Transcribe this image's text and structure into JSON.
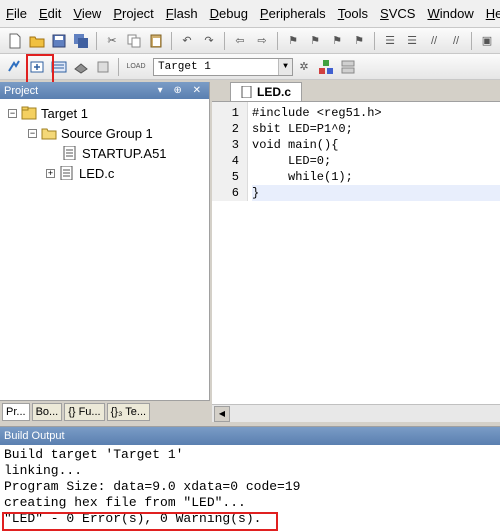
{
  "menu": [
    "File",
    "Edit",
    "View",
    "Project",
    "Flash",
    "Debug",
    "Peripherals",
    "Tools",
    "SVCS",
    "Window",
    "Help"
  ],
  "toolbar": {
    "load_label": "LOAD",
    "target_value": "Target 1"
  },
  "project_pane": {
    "title": "Project",
    "controls": "▾ ⊕ ✕",
    "tree": {
      "root": "Target 1",
      "group": "Source Group 1",
      "files": [
        "STARTUP.A51",
        "LED.c"
      ]
    },
    "tabs": [
      "Pr...",
      "Bo...",
      "{} Fu...",
      "{}₃ Te..."
    ]
  },
  "editor": {
    "tab_label": "LED.c",
    "lines": [
      {
        "num": "1",
        "code": "#include <reg51.h>"
      },
      {
        "num": "2",
        "code": "sbit LED=P1^0;"
      },
      {
        "num": "3",
        "code": "void main(){"
      },
      {
        "num": "4",
        "code": "     LED=0;"
      },
      {
        "num": "5",
        "code": "     while(1);"
      },
      {
        "num": "6",
        "code": "}"
      }
    ]
  },
  "build_output": {
    "title": "Build Output",
    "lines": [
      "Build target 'Target 1'",
      "linking...",
      "Program Size: data=9.0 xdata=0 code=19",
      "creating hex file from \"LED\"...",
      "\"LED\" - 0 Error(s), 0 Warning(s)."
    ]
  },
  "colors": {
    "highlight": "#e02020",
    "header": "#5a7fb0"
  }
}
